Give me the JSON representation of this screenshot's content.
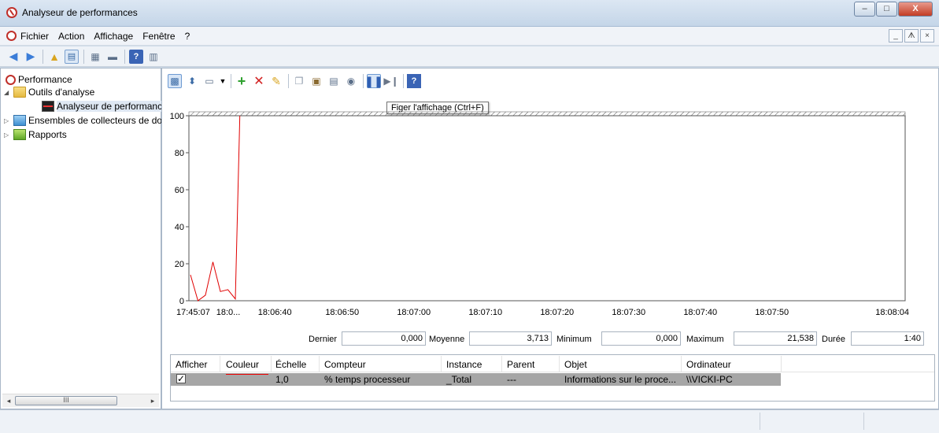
{
  "window": {
    "title": "Analyseur de performances",
    "controls": [
      "–",
      "□",
      "X"
    ]
  },
  "menubar": {
    "items": [
      "Fichier",
      "Action",
      "Affichage",
      "Fenêtre",
      "?"
    ],
    "mdi_controls": [
      "_",
      "ᗑ",
      "×"
    ]
  },
  "tree": {
    "items": [
      {
        "label": "Performance",
        "icon": "performance-icon"
      },
      {
        "label": "Outils d'analyse",
        "icon": "folder-icon",
        "expanded": true
      },
      {
        "label": "Analyseur de performances",
        "icon": "monitor-icon",
        "selected": true
      },
      {
        "label": "Ensembles de collecteurs de données",
        "icon": "collector-sets-icon"
      },
      {
        "label": "Rapports",
        "icon": "reports-icon"
      }
    ],
    "scroll_thumb": "III"
  },
  "graph_toolbar": {
    "tooltip": "Figer l'affichage (Ctrl+F)"
  },
  "chart_data": {
    "type": "line",
    "ylim": [
      0,
      100
    ],
    "yticks": [
      "0",
      "20",
      "40",
      "60",
      "80",
      "100"
    ],
    "xticks": [
      "17:45:07",
      "18:0...",
      "18:06:40",
      "18:06:50",
      "18:07:00",
      "18:07:10",
      "18:07:20",
      "18:07:30",
      "18:07:40",
      "18:07:50",
      "18:08:04"
    ],
    "series": [
      {
        "color": "#e00000",
        "points": [
          [
            0,
            14
          ],
          [
            1,
            0
          ],
          [
            2,
            3
          ],
          [
            3,
            21
          ],
          [
            4,
            5
          ],
          [
            5,
            6
          ],
          [
            6,
            1
          ],
          [
            6.6,
            100
          ]
        ]
      }
    ]
  },
  "stats": {
    "last_label": "Dernier",
    "last_value": "0,000",
    "avg_label": "Moyenne",
    "avg_value": "3,713",
    "min_label": "Minimum",
    "min_value": "0,000",
    "max_label": "Maximum",
    "max_value": "21,538",
    "duration_label": "Durée",
    "duration_value": "1:40"
  },
  "counters": {
    "headers": [
      "Afficher",
      "Couleur",
      "Échelle",
      "Compteur",
      "Instance",
      "Parent",
      "Objet",
      "Ordinateur"
    ],
    "rows": [
      {
        "show": "✓",
        "scale": "1,0",
        "counter": "% temps processeur",
        "instance": "_Total",
        "parent": "---",
        "object": "Informations sur le proce...",
        "computer": "\\\\VICKI-PC"
      }
    ]
  },
  "colors": {
    "accent": "#c0302a",
    "line": "#e00000",
    "selected_row": "#a6a6a6"
  }
}
